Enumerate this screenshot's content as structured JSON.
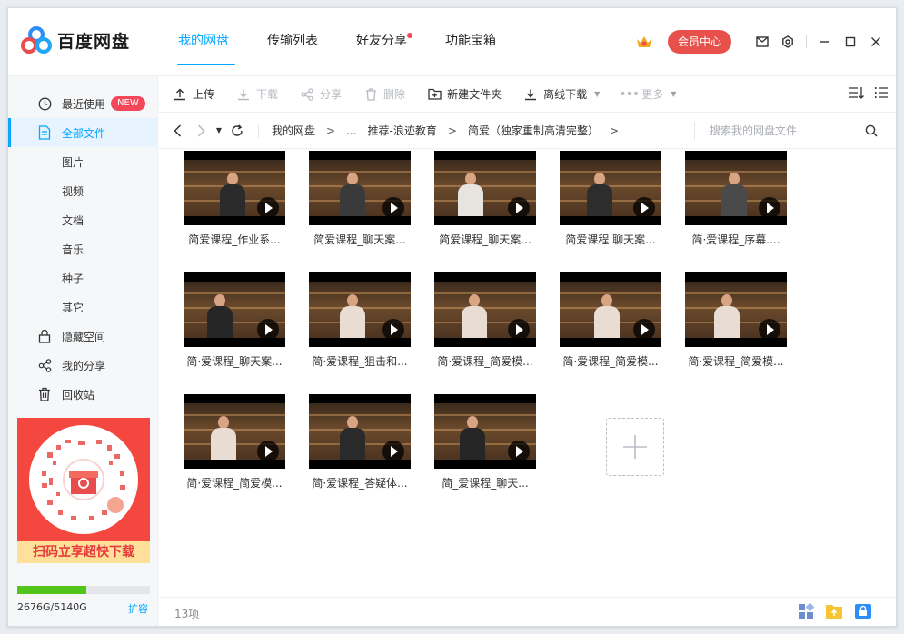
{
  "app": {
    "name": "百度网盘"
  },
  "nav": {
    "tabs": [
      {
        "label": "我的网盘",
        "active": true
      },
      {
        "label": "传输列表"
      },
      {
        "label": "好友分享",
        "dot": true
      },
      {
        "label": "功能宝箱"
      }
    ]
  },
  "header": {
    "vip_label": "会员中心"
  },
  "sidebar": {
    "items": [
      {
        "label": "最近使用",
        "badge": "NEW",
        "icon": "clock-icon"
      },
      {
        "label": "全部文件",
        "icon": "file-icon",
        "active": true
      },
      {
        "label": "图片",
        "sub": true
      },
      {
        "label": "视频",
        "sub": true
      },
      {
        "label": "文档",
        "sub": true
      },
      {
        "label": "音乐",
        "sub": true
      },
      {
        "label": "种子",
        "sub": true
      },
      {
        "label": "其它",
        "sub": true
      },
      {
        "label": "隐藏空间",
        "icon": "lock-icon"
      },
      {
        "label": "我的分享",
        "icon": "share-icon"
      },
      {
        "label": "回收站",
        "icon": "trash-icon"
      }
    ],
    "promo_text": "扫码立享超快下载",
    "quota": {
      "text": "2676G/5140G",
      "used_fraction": 0.52,
      "expand_label": "扩容"
    }
  },
  "toolbar": {
    "upload": "上传",
    "download": "下载",
    "share": "分享",
    "delete": "删除",
    "new_folder": "新建文件夹",
    "offline_download": "离线下载",
    "more": "更多"
  },
  "path": {
    "crumbs": [
      "我的网盘",
      "...",
      "推荐-浪迹教育",
      "简爱（独家重制高清完整）"
    ],
    "search_placeholder": "搜索我的网盘文件"
  },
  "files": [
    {
      "name": "简爱课程_作业系..."
    },
    {
      "name": "简爱课程_聊天案..."
    },
    {
      "name": "简爱课程_聊天案..."
    },
    {
      "name": "简爱课程 聊天案..."
    },
    {
      "name": "简·爱课程_序幕...."
    },
    {
      "name": "简·爱课程_聊天案..."
    },
    {
      "name": "简·爱课程_狙击和..."
    },
    {
      "name": "简·爱课程_简爱模..."
    },
    {
      "name": "简·爱课程_简爱模..."
    },
    {
      "name": "简·爱课程_简爱模..."
    },
    {
      "name": "简·爱课程_简爱模..."
    },
    {
      "name": "简·爱课程_答疑体..."
    },
    {
      "name": "简_爱课程_聊天..."
    }
  ],
  "status": {
    "count": "13项"
  },
  "colors": {
    "accent": "#06a7ff",
    "vip": "#e8504b",
    "new_badge": "#f5475a"
  }
}
